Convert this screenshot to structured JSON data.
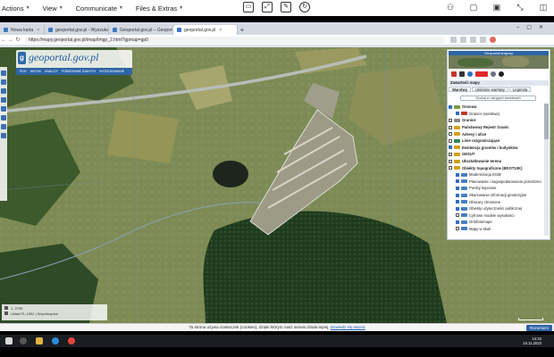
{
  "remote_toolbar": {
    "menus": [
      "Actions",
      "View",
      "Communicate",
      "Files & Extras"
    ]
  },
  "browser": {
    "tabs": [
      {
        "label": "Nowa karta"
      },
      {
        "label": "geoportal.gov.pl - Wyszukaj"
      },
      {
        "label": "Geoportal.gov.pl – Geoportal Infr"
      },
      {
        "label": "geoportal.gov.pl"
      }
    ],
    "new_tab": "+",
    "url": "https://mapy.geoportal.gov.pl/imap/Imgp_2.html?gpmap=gp0"
  },
  "site": {
    "logo_text": "geoportal.gov.pl",
    "nav": [
      "PLIK",
      "WIDOK",
      "ANALIZY",
      "POBIERANIE DANYCH",
      "WYSZUKIWANIE"
    ]
  },
  "panel": {
    "minimap_title": "Geoportal krajowy",
    "header": "Zawartość mapy",
    "tabs": [
      "Warstwy",
      "Ulubione warstwy",
      "Legenda"
    ],
    "search_placeholder": "Szukaj w usługach warstwach",
    "layers": [
      {
        "label": "Osnowa",
        "kind": "group",
        "checked": true,
        "color": "#7a9a3c"
      },
      {
        "label": "Granice (warstwa)",
        "kind": "sub",
        "checked": true,
        "color": "#c0392b"
      },
      {
        "label": "Granice",
        "kind": "group",
        "checked": false,
        "color": "#888888"
      },
      {
        "label": "Państwowy Rejestr Granic",
        "kind": "group",
        "checked": false,
        "color": "#d4a017"
      },
      {
        "label": "Adresy i ulice",
        "kind": "group",
        "checked": false,
        "color": "#d4a017"
      },
      {
        "label": "Linie rozgraniczające",
        "kind": "group",
        "checked": false,
        "color": "#2e8b57"
      },
      {
        "label": "Ewidencja gruntów i budynków",
        "kind": "group",
        "checked": true,
        "color": "#d4a017"
      },
      {
        "label": "GESUT",
        "kind": "group",
        "checked": false,
        "color": "#d4a017"
      },
      {
        "label": "Ukształtowanie terenu",
        "kind": "group",
        "checked": false,
        "color": "#d4a017"
      },
      {
        "label": "Obiekty topograficzne (BDOT10K)",
        "kind": "group",
        "checked": false,
        "color": "#d4a017"
      },
      {
        "label": "Modernizacja EGiB",
        "kind": "sub",
        "checked": true,
        "color": "#4a7fc1"
      },
      {
        "label": "Planowanie i zagospodarowanie przestrzenne",
        "kind": "sub",
        "checked": true,
        "color": "#4a7fc1"
      },
      {
        "label": "Punkty kopcowe",
        "kind": "sub",
        "checked": true,
        "color": "#4a7fc1"
      },
      {
        "label": "Skanowanie informacji geodezyjne",
        "kind": "sub",
        "checked": true,
        "color": "#4a7fc1"
      },
      {
        "label": "Obszary chronione",
        "kind": "sub",
        "checked": true,
        "color": "#4a7fc1"
      },
      {
        "label": "Obiekty użyteczności publicznej",
        "kind": "sub",
        "checked": true,
        "color": "#4a7fc1"
      },
      {
        "label": "Cyfrowe modele wysokości",
        "kind": "sub",
        "checked": false,
        "color": "#4a7fc1"
      },
      {
        "label": "Ortofotomapa",
        "kind": "sub",
        "checked": true,
        "color": "#4a7fc1"
      },
      {
        "label": "Mapy w skali",
        "kind": "sub",
        "checked": false,
        "color": "#4a7fc1"
      }
    ]
  },
  "scale_box": {
    "line1": "1: 2795",
    "line2": "Układ PL-1992 | Współrzędne"
  },
  "cookie": {
    "text": "Ta strona używa ciasteczek (cookies), dzięki którym nasz serwis działa lepiej.",
    "link": "Dowiedz się więcej",
    "button": "Rozumiem"
  },
  "taskbar": {
    "time": "14:34",
    "date": "24.11.2023"
  }
}
